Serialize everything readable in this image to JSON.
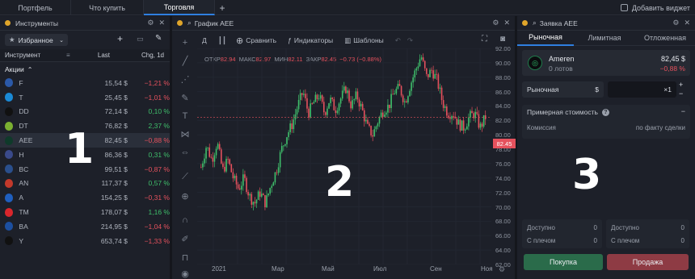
{
  "top_tabs": [
    "Портфель",
    "Что купить",
    "Торговля"
  ],
  "top_right": "Добавить виджет",
  "instruments": {
    "title": "Инструменты",
    "favorites": "Избранное",
    "col_instrument": "Инструмент",
    "col_last": "Last",
    "col_chg": "Chg, 1d",
    "group": "Акции",
    "rows": [
      {
        "ticker": "F",
        "last": "15,54 $",
        "chg": "−1,21 %",
        "dir": "neg",
        "color": "#2b59a8",
        "mark": "Ford"
      },
      {
        "ticker": "T",
        "last": "25,45 $",
        "chg": "−1,01 %",
        "dir": "neg",
        "color": "#1a8ad6",
        "mark": "AT&T"
      },
      {
        "ticker": "DD",
        "last": "72,14 $",
        "chg": "0,10 %",
        "dir": "pos",
        "color": "#111111",
        "mark": "DD"
      },
      {
        "ticker": "DT",
        "last": "76,82 $",
        "chg": "2,37 %",
        "dir": "pos",
        "color": "#7bb031",
        "mark": "DT"
      },
      {
        "ticker": "AEE",
        "last": "82,45 $",
        "chg": "−0,88 %",
        "dir": "neg",
        "color": "#0f3a2a",
        "mark": "AEE",
        "selected": true
      },
      {
        "ticker": "H",
        "last": "86,36 $",
        "chg": "0,31 %",
        "dir": "pos",
        "color": "#3a4a8a",
        "mark": "H"
      },
      {
        "ticker": "BC",
        "last": "99,51 $",
        "chg": "−0,87 %",
        "dir": "neg",
        "color": "#2a4f8c",
        "mark": "BC"
      },
      {
        "ticker": "AN",
        "last": "117,37 $",
        "chg": "0,57 %",
        "dir": "pos",
        "color": "#c2392b",
        "mark": "AN"
      },
      {
        "ticker": "A",
        "last": "154,25 $",
        "chg": "−0,31 %",
        "dir": "neg",
        "color": "#1f5fbf",
        "mark": "A"
      },
      {
        "ticker": "TM",
        "last": "178,07 $",
        "chg": "1,16 %",
        "dir": "pos",
        "color": "#d9262c",
        "mark": "TM"
      },
      {
        "ticker": "BA",
        "last": "214,95 $",
        "chg": "−1,04 %",
        "dir": "neg",
        "color": "#1c4fa0",
        "mark": "BA"
      },
      {
        "ticker": "Y",
        "last": "653,74 $",
        "chg": "−1,33 %",
        "dir": "neg",
        "color": "#111111",
        "mark": "Y"
      }
    ]
  },
  "chart": {
    "title": "График AEE",
    "interval": "Д",
    "compare": "Сравнить",
    "indicators": "Индикаторы",
    "templates": "Шаблоны",
    "ohlc": {
      "open_label": "ОТКР",
      "open": "82.94",
      "high_label": "МАКС",
      "high": "82.97",
      "low_label": "МИН",
      "low": "82.11",
      "close_label": "ЗАКР",
      "close": "82.45",
      "change": "−0.73 (−0.88%)"
    },
    "price_tag": "82.45",
    "y_ticks": [
      "92.00",
      "90.00",
      "88.00",
      "86.00",
      "84.00",
      "82.00",
      "80.00",
      "78.00",
      "76.00",
      "74.00",
      "72.00",
      "70.00",
      "68.00",
      "66.00",
      "64.00",
      "62.00"
    ],
    "x_ticks": [
      "2021",
      "Мар",
      "Май",
      "Июл",
      "Сен",
      "Ноя"
    ],
    "colors": {
      "up": "#3fbf6b",
      "down": "#e5515d"
    }
  },
  "chart_data": {
    "type": "candlestick",
    "ylim": [
      62,
      92
    ],
    "x_labels": [
      "2021",
      "Мар",
      "Май",
      "Июл",
      "Сен",
      "Ноя"
    ],
    "close_path": [
      75.5,
      78.5,
      76.5,
      79,
      75,
      76.5,
      74,
      72.5,
      74,
      71.5,
      70.5,
      72,
      70.5,
      73,
      75,
      78,
      80,
      81.5,
      84,
      86,
      83,
      84.5,
      85.5,
      83,
      85,
      83.5,
      85,
      86.5,
      84,
      85.5,
      83.5,
      81,
      80,
      82,
      83.5,
      84,
      86,
      86.5,
      84.5,
      87,
      89,
      91,
      88,
      89,
      87.5,
      84.5,
      83,
      83,
      81.5,
      81,
      82.5,
      83,
      81,
      82.45
    ]
  },
  "order": {
    "title": "Заявка AEE",
    "tabs": [
      "Рыночная",
      "Лимитная",
      "Отложенная"
    ],
    "name": "Ameren",
    "lots": "0 лотов",
    "price": "82,45 $",
    "change": "−0,88 %",
    "type": "Рыночная",
    "currency": "$",
    "qty": "×1",
    "approx_label": "Примерная стоимость",
    "fee_label": "Комиссия",
    "fee_value": "по факту сделки",
    "avail1_label": "Доступно",
    "avail1": "0",
    "margin1_label": "С плечом",
    "margin1": "0",
    "avail2_label": "Доступно",
    "avail2": "0",
    "margin2_label": "С плечом",
    "margin2": "0",
    "buy": "Покупка",
    "sell": "Продажа"
  },
  "overlays": [
    "1",
    "2",
    "3"
  ]
}
